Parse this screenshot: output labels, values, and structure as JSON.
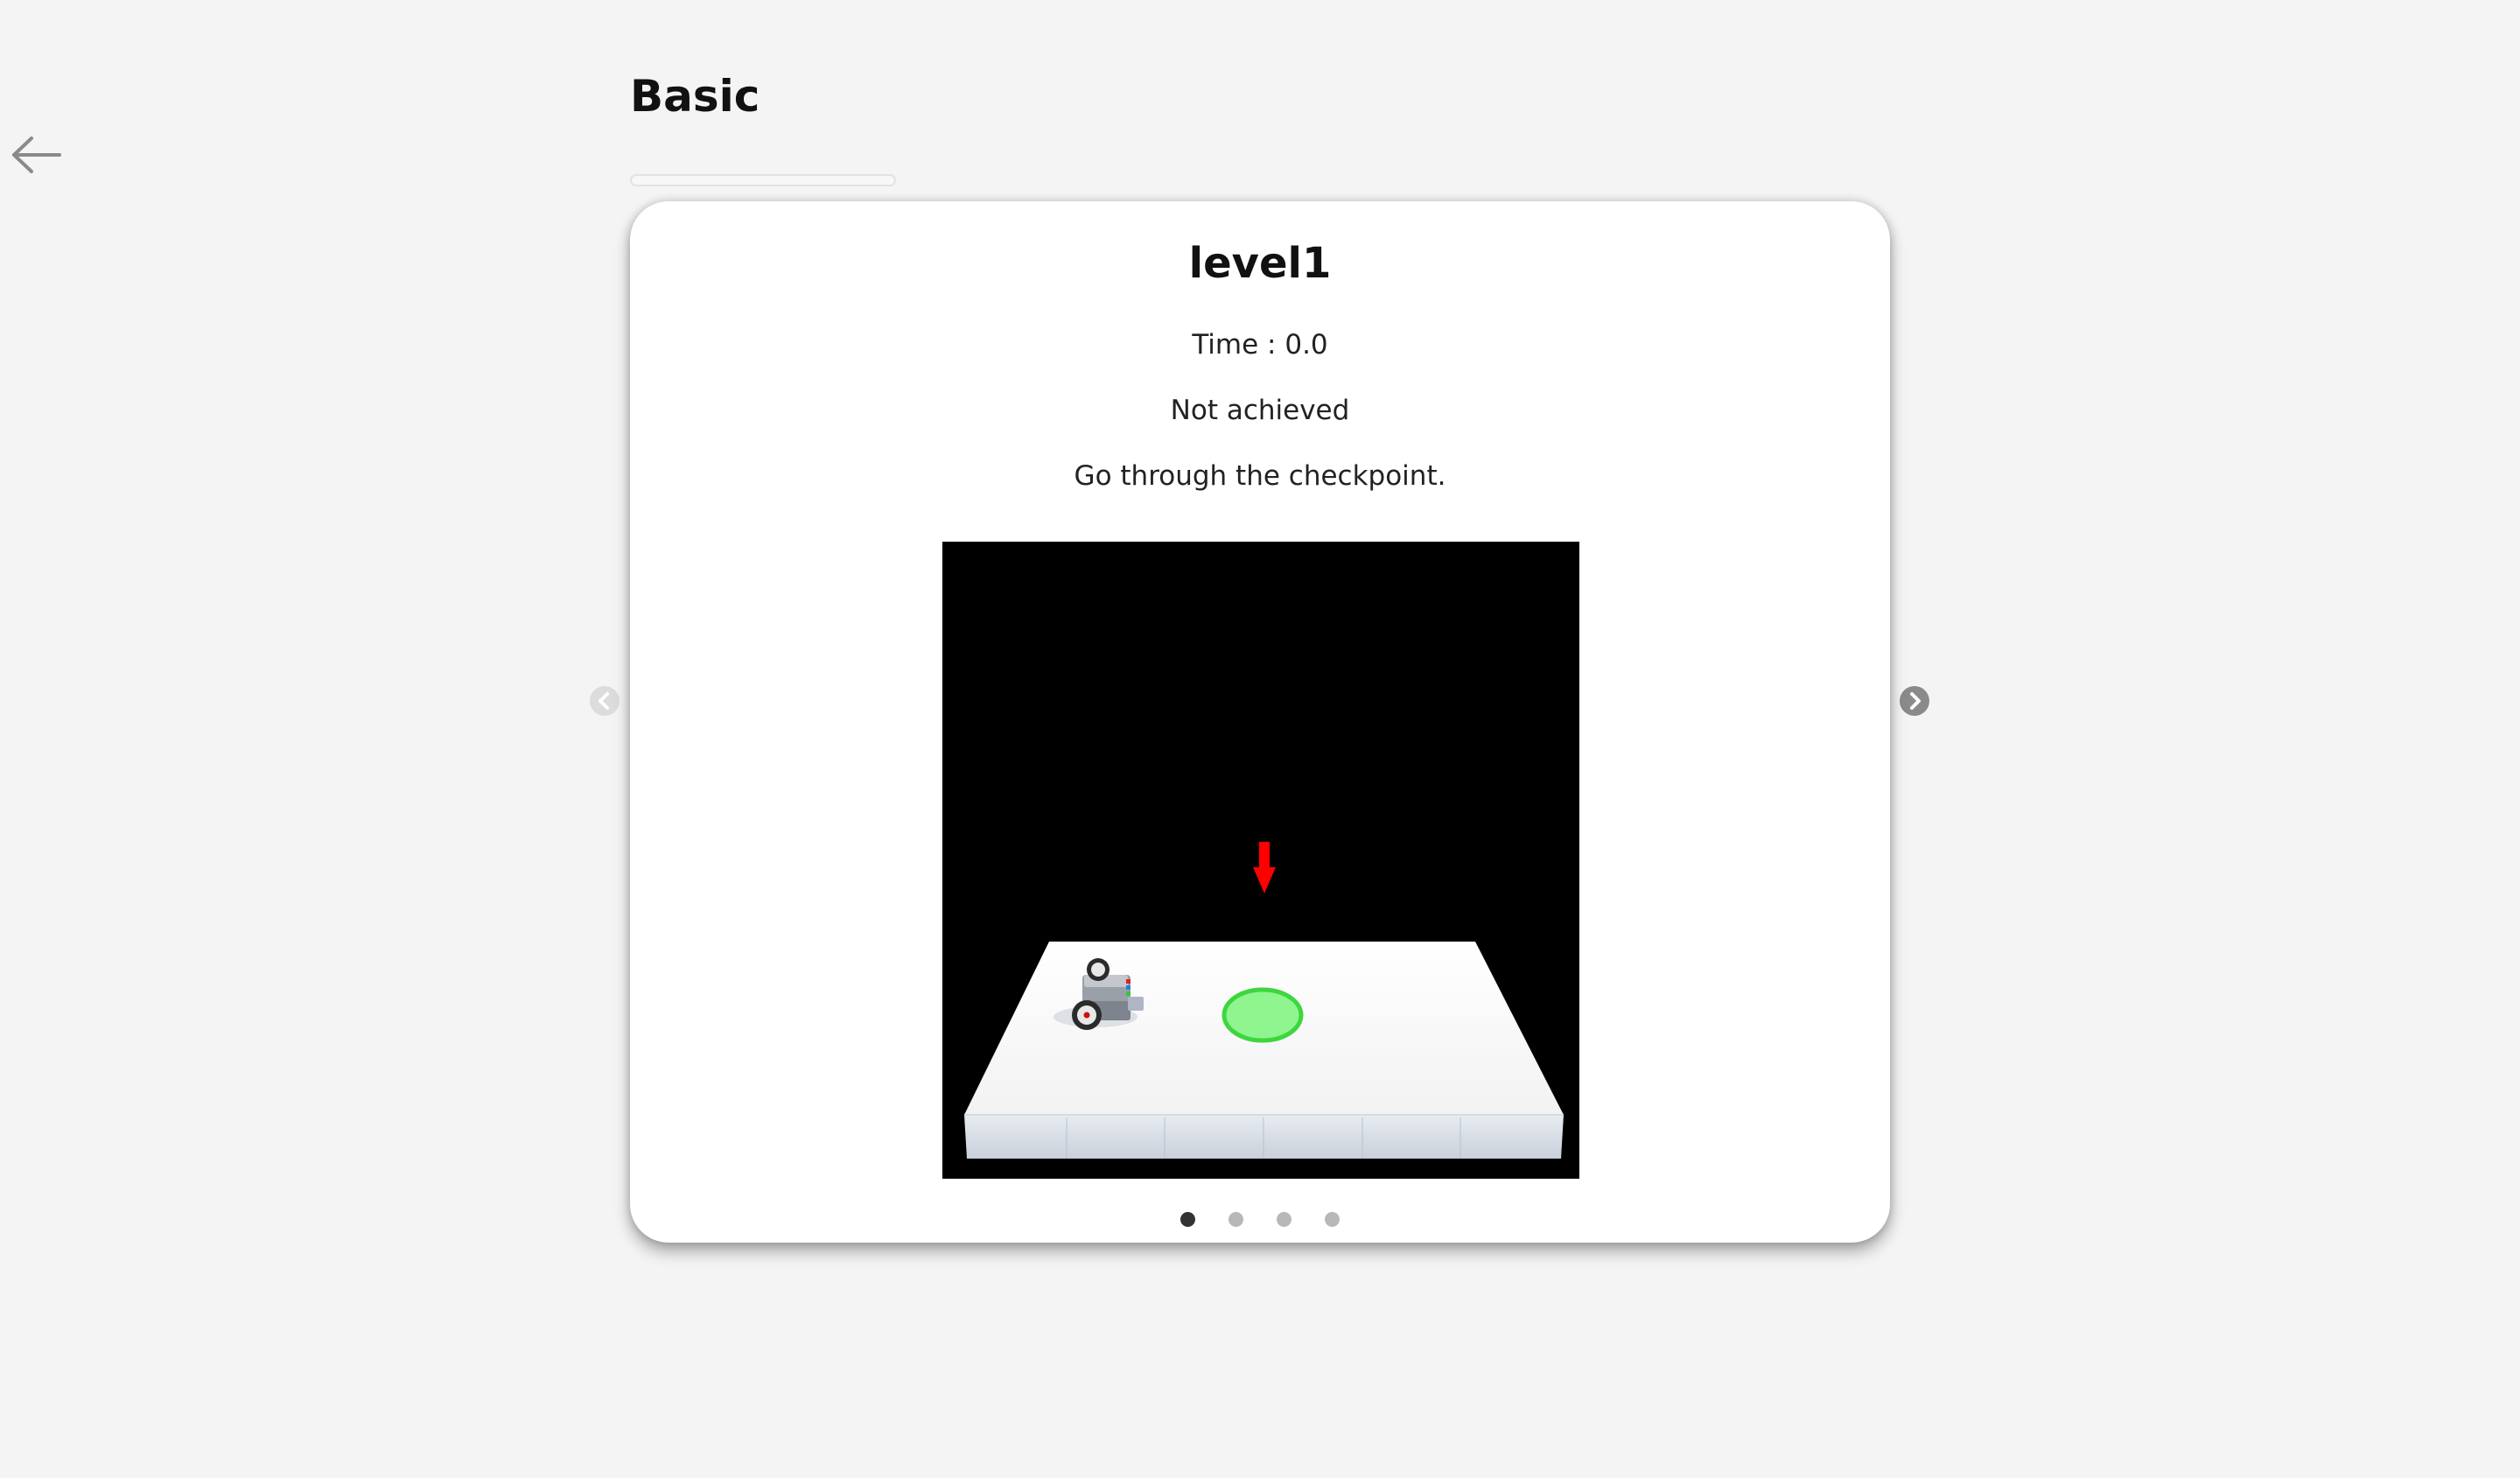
{
  "header": {
    "title": "Basic",
    "back_icon": "arrow-left-icon",
    "progress_fraction": 0.0
  },
  "level": {
    "title": "level1",
    "time": "Time : 0.0",
    "status": "Not achieved",
    "description": "Go through the checkpoint."
  },
  "scene": {
    "background_color": "#000000",
    "platform_color": "#ffffff",
    "checkpoint_color": "#7ef27e",
    "marker_color": "#ff0000",
    "marker_icon": "arrow-down-icon",
    "robot_icon": "robot-car-icon"
  },
  "carousel": {
    "page_count": 4,
    "active_index": 0,
    "prev_icon": "chevron-left-icon",
    "next_icon": "chevron-right-icon"
  }
}
